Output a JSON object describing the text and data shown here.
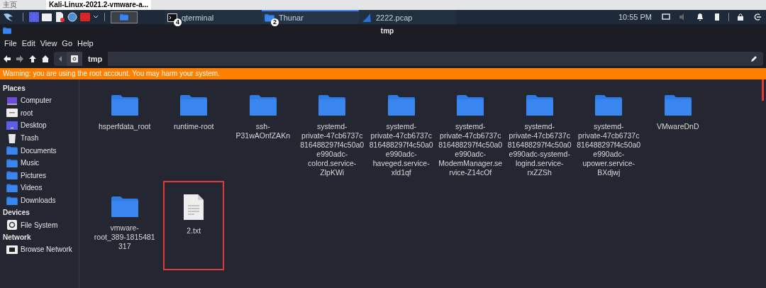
{
  "browser_tabs": [
    {
      "label": "主页",
      "selected": false
    },
    {
      "label": "Kali-Linux-2021.2-vmware-a...",
      "selected": true
    }
  ],
  "taskbar": {
    "tasks": [
      {
        "label": "qterminal",
        "badge": "4",
        "kind": "terminal",
        "selected": false
      },
      {
        "label": "Thunar",
        "badge": "2",
        "kind": "folder",
        "selected": true
      },
      {
        "label": "2222.pcap",
        "kind": "shark",
        "selected": false
      }
    ],
    "clock": "10:55 PM"
  },
  "window": {
    "title": "tmp"
  },
  "menu": [
    "File",
    "Edit",
    "View",
    "Go",
    "Help"
  ],
  "path": {
    "segment": "tmp"
  },
  "warning": "Warning: you are using the root account. You may harm your system.",
  "sidebar": [
    {
      "heading": "Places",
      "items": [
        {
          "label": "Computer",
          "kind": "computer"
        },
        {
          "label": "root",
          "kind": "home"
        },
        {
          "label": "Desktop",
          "kind": "desktop"
        },
        {
          "label": "Trash",
          "kind": "trash"
        },
        {
          "label": "Documents",
          "kind": "folder"
        },
        {
          "label": "Music",
          "kind": "folder"
        },
        {
          "label": "Pictures",
          "kind": "folder"
        },
        {
          "label": "Videos",
          "kind": "folder"
        },
        {
          "label": "Downloads",
          "kind": "folder"
        }
      ]
    },
    {
      "heading": "Devices",
      "items": [
        {
          "label": "File System",
          "kind": "drive"
        }
      ]
    },
    {
      "heading": "Network",
      "items": [
        {
          "label": "Browse Network",
          "kind": "network"
        }
      ]
    }
  ],
  "files": [
    {
      "kind": "folder",
      "label_lines": [
        "hsperfdata_root"
      ],
      "highlighted": false
    },
    {
      "kind": "folder",
      "label_lines": [
        "runtime-root"
      ],
      "highlighted": false
    },
    {
      "kind": "folder",
      "label_lines": [
        "ssh-",
        "P31wAOnfZAKn"
      ],
      "highlighted": false
    },
    {
      "kind": "folder",
      "label_lines": [
        "systemd-",
        "private-47cb6737c",
        "816488297f4c50a0",
        "e990adc-",
        "colord.service-",
        "ZlpKWi"
      ],
      "highlighted": false
    },
    {
      "kind": "folder",
      "label_lines": [
        "systemd-",
        "private-47cb6737c",
        "816488297f4c50a0",
        "e990adc-",
        "haveged.service-",
        "xld1qf"
      ],
      "highlighted": false
    },
    {
      "kind": "folder",
      "label_lines": [
        "systemd-",
        "private-47cb6737c",
        "816488297f4c50a0",
        "e990adc-",
        "ModemManager.se",
        "rvice-Z14cOf"
      ],
      "highlighted": false
    },
    {
      "kind": "folder",
      "label_lines": [
        "systemd-",
        "private-47cb6737c",
        "816488297f4c50a0",
        "e990adc-systemd-",
        "logind.service-",
        "rxZZSh"
      ],
      "highlighted": false
    },
    {
      "kind": "folder",
      "label_lines": [
        "systemd-",
        "private-47cb6737c",
        "816488297f4c50a0",
        "e990adc-",
        "upower.service-",
        "BXdjwj"
      ],
      "highlighted": false
    },
    {
      "kind": "folder",
      "label_lines": [
        "VMwareDnD"
      ],
      "highlighted": false
    },
    {
      "kind": "folder",
      "label_lines": [
        "vmware-",
        "root_389-1815481",
        "317"
      ],
      "highlighted": false
    },
    {
      "kind": "text",
      "label_lines": [
        "2.txt"
      ],
      "highlighted": true
    }
  ]
}
